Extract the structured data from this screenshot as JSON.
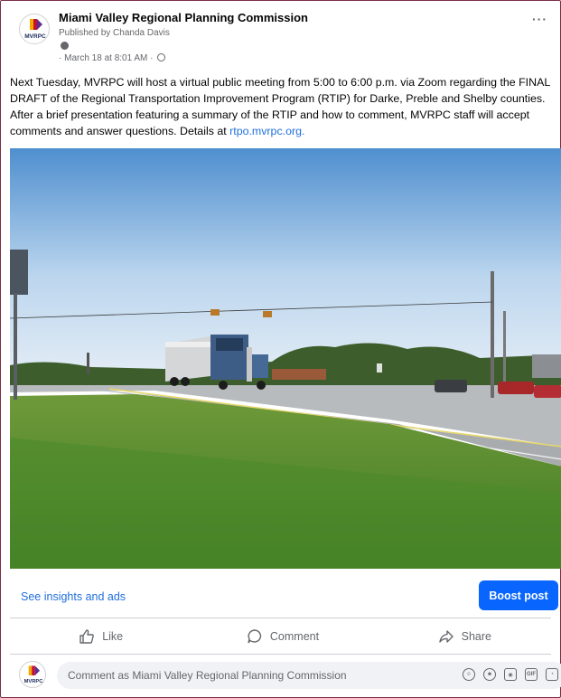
{
  "post": {
    "page_name": "Miami Valley Regional Planning Commission",
    "published_by": "Published by Chanda Davis",
    "timestamp": "· March 18 at 8:01 AM ·",
    "body": "Next Tuesday, MVRPC will host a virtual public meeting from 5:00 to 6:00 p.m. via Zoom regarding the FINAL DRAFT of the Regional Transportation Improvement Program (RTIP) for Darke, Preble and Shelby counties. After a brief presentation featuring a summary of the RTIP and how to comment, MVRPC staff will accept comments and answer questions. Details at",
    "link_text": "rtpo.mvrpc.org.",
    "more_label": "···"
  },
  "logo": {
    "text": "MVRPC",
    "colors": [
      "#f2a900",
      "#c8102e",
      "#5c2d91"
    ]
  },
  "footer": {
    "insights_label": "See insights and ads",
    "boost_label": "Boost post"
  },
  "actions": {
    "like_label": "Like",
    "comment_label": "Comment",
    "share_label": "Share"
  },
  "comment": {
    "placeholder": "Comment as Miami Valley Regional Planning Commission",
    "icons": [
      "avatar-sticker-icon",
      "emoji-icon",
      "camera-icon",
      "gif-icon",
      "sticker-icon"
    ],
    "gif_text": "GIF"
  },
  "colors": {
    "accent": "#0866ff",
    "link": "#216fdb",
    "muted": "#65676b"
  }
}
